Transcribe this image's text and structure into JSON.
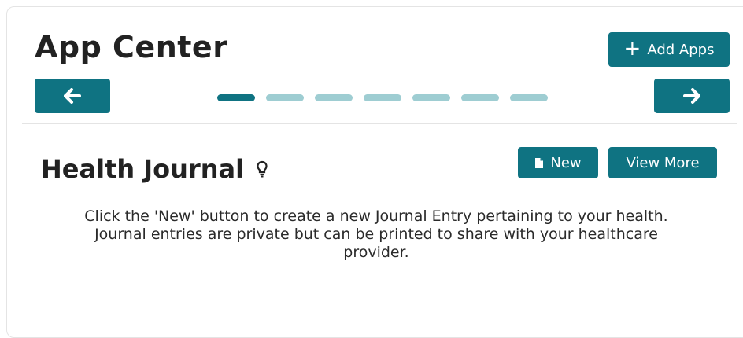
{
  "header": {
    "title": "App Center",
    "add_apps_label": "Add Apps",
    "add_apps_icon": "plus-icon",
    "prev_icon": "arrow-left-icon",
    "next_icon": "arrow-right-icon"
  },
  "carousel": {
    "page_count": 7,
    "current_page": 1
  },
  "app": {
    "title": "Health Journal",
    "title_icon": "lightbulb-icon",
    "new_label": "New",
    "new_icon": "document-icon",
    "view_more_label": "View More",
    "description": "Click the 'New' button to create a new Journal Entry pertaining to your health. Journal entries are private but can be printed to share with your healthcare provider."
  },
  "colors": {
    "accent": "#0f7382",
    "dot_inactive": "#9ecdd2",
    "text": "#222222"
  }
}
